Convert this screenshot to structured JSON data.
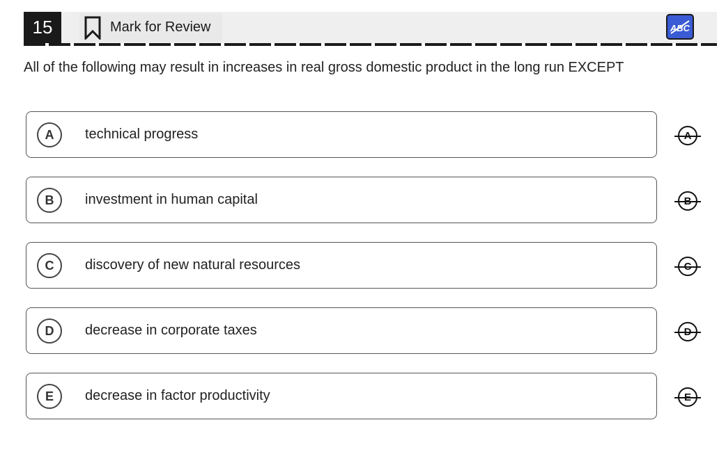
{
  "header": {
    "question_number": "15",
    "mark_review_label": "Mark for Review",
    "bookmark_icon": "bookmark-icon",
    "abc_toggle_label": "ABC",
    "abc_toggle_color": "#3a5bd4"
  },
  "question": {
    "text": "All of the following may result in increases in real gross domestic product in the long run EXCEPT"
  },
  "options": [
    {
      "letter": "A",
      "text": "technical progress"
    },
    {
      "letter": "B",
      "text": "investment in human capital"
    },
    {
      "letter": "C",
      "text": "discovery of new natural resources"
    },
    {
      "letter": "D",
      "text": "decrease in corporate taxes"
    },
    {
      "letter": "E",
      "text": "decrease in factor productivity"
    }
  ]
}
